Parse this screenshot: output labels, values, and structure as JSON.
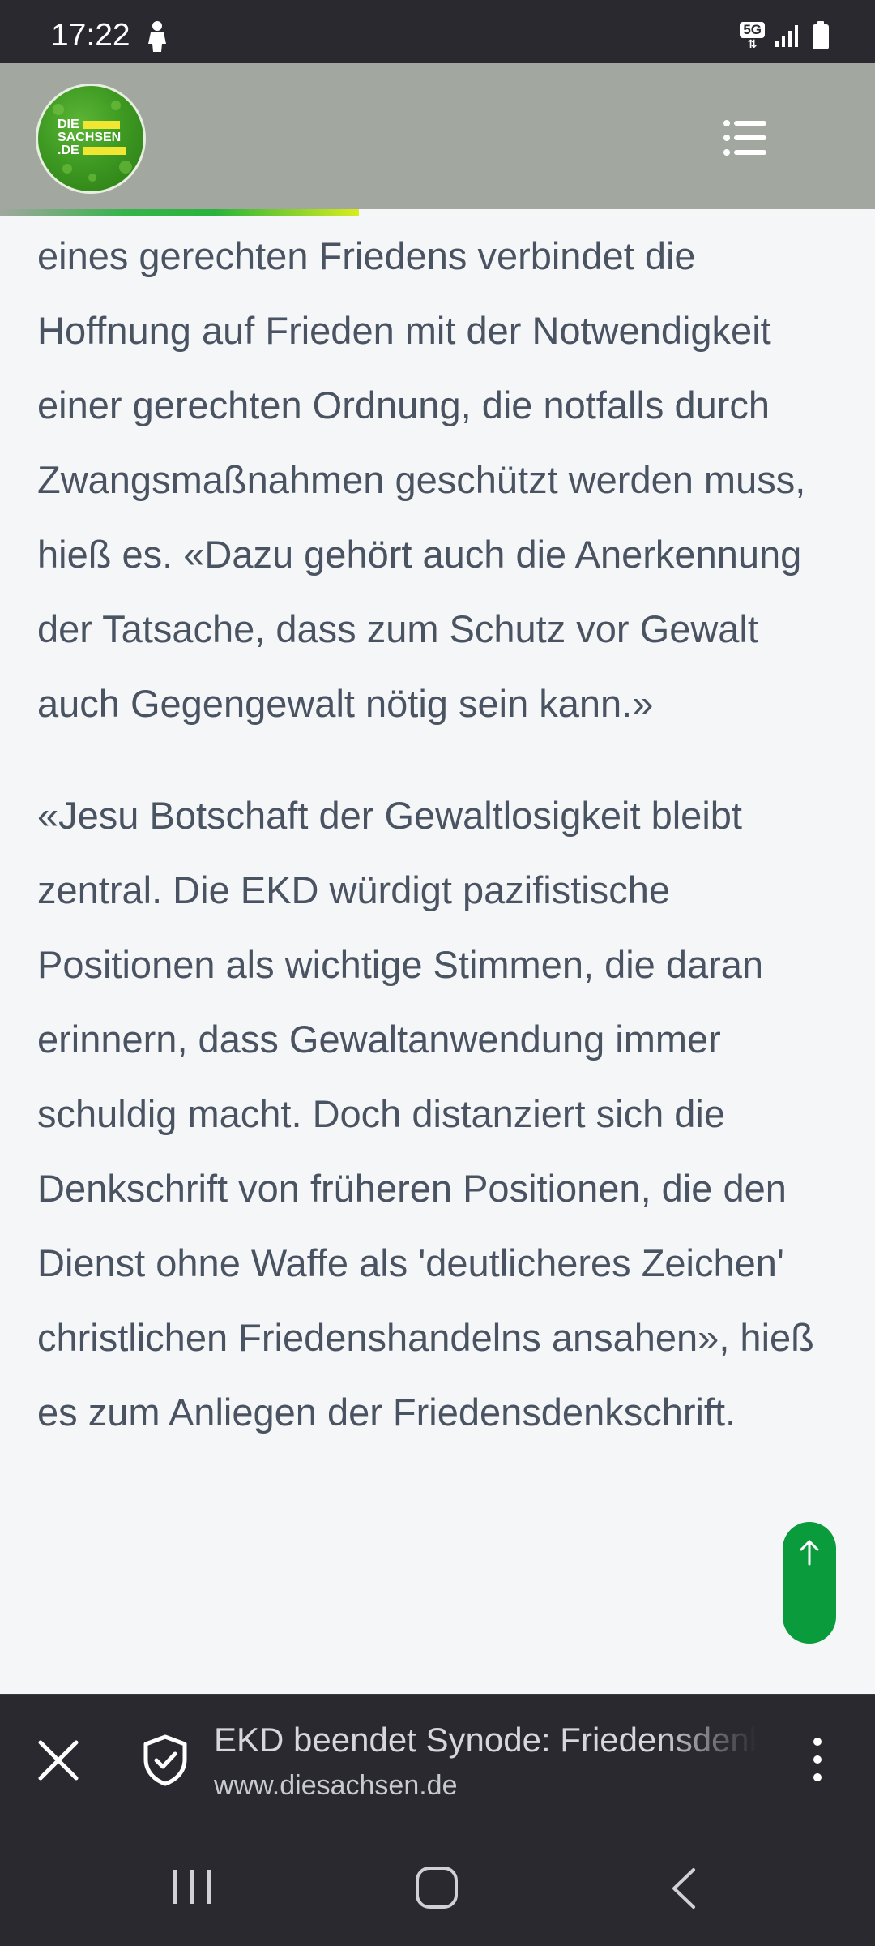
{
  "status_bar": {
    "time": "17:22",
    "network_badge": "5G"
  },
  "header": {
    "logo_text": [
      "DIE",
      "SACHSEN",
      ".DE"
    ],
    "menu_icon": "list-menu-icon",
    "read_progress": 0.41
  },
  "article": {
    "paragraphs": [
      "eines gerechten Friedens verbindet die Hoffnung auf Frieden mit der Notwendigkeit einer gerechten Ordnung, die notfalls durch Zwangsmaßnahmen geschützt werden muss, hieß es. «Dazu gehört auch die Anerkennung der Tatsache, dass zum Schutz vor Gewalt auch Gegengewalt nötig sein kann.»",
      "«Jesu Botschaft der Gewaltlosigkeit bleibt zentral. Die EKD würdigt pazifistische Positionen als wichtige Stimmen, die daran erinnern, dass Gewaltanwendung immer schuldig macht. Doch distanziert sich die Denkschrift von früheren Positionen, die den Dienst ohne Waffe als 'deutlicheres Zeichen' christlichen Friedenshandelns ansahen», hieß es zum Anliegen der Friedensdenkschrift."
    ]
  },
  "custom_tab": {
    "title": "EKD beendet Synode: Friedensdenkschrift",
    "url": "www.diesachsen.de"
  },
  "colors": {
    "status_bar": "#2a2930",
    "header_bg": "#a2a79f",
    "article_text": "#4a5361",
    "scroll_button": "#0a9b3d",
    "page_bg": "#f5f6f8"
  }
}
